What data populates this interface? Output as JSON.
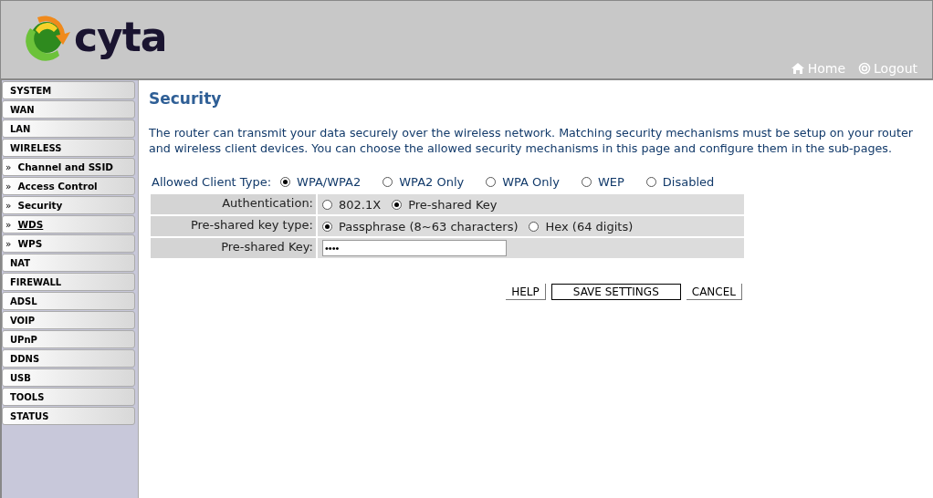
{
  "header": {
    "logo_text": "cyta",
    "links": [
      {
        "kind": "home",
        "label": "Home"
      },
      {
        "kind": "logout",
        "label": "Logout"
      }
    ]
  },
  "sidebar": {
    "items": [
      {
        "kind": "section",
        "label": "SYSTEM"
      },
      {
        "kind": "section",
        "label": "WAN"
      },
      {
        "kind": "section",
        "label": "LAN"
      },
      {
        "kind": "section",
        "label": "WIRELESS"
      },
      {
        "kind": "sub",
        "label": "Channel and SSID",
        "marker": "»"
      },
      {
        "kind": "sub",
        "label": "Access Control",
        "marker": "»"
      },
      {
        "kind": "sub",
        "label": "Security",
        "marker": "»"
      },
      {
        "kind": "sub",
        "label": "WDS",
        "marker": "»",
        "underlined": true
      },
      {
        "kind": "sub",
        "label": "WPS",
        "marker": "»"
      },
      {
        "kind": "section",
        "label": "NAT"
      },
      {
        "kind": "section",
        "label": "FIREWALL"
      },
      {
        "kind": "section",
        "label": "ADSL"
      },
      {
        "kind": "section",
        "label": "VOIP"
      },
      {
        "kind": "section",
        "label": "UPnP"
      },
      {
        "kind": "section",
        "label": "DDNS"
      },
      {
        "kind": "section",
        "label": "USB"
      },
      {
        "kind": "section",
        "label": "TOOLS"
      },
      {
        "kind": "section",
        "label": "STATUS"
      }
    ]
  },
  "page": {
    "title": "Security",
    "description": "The router can transmit your data securely over the wireless network. Matching security mechanisms must be setup on your router and wireless client devices. You can choose the allowed security mechanisms in this page and configure them in the sub-pages.",
    "client_type": {
      "label": "Allowed Client Type:",
      "options": [
        {
          "label": "WPA/WPA2",
          "selected": true
        },
        {
          "label": "WPA2 Only",
          "selected": false
        },
        {
          "label": "WPA Only",
          "selected": false
        },
        {
          "label": "WEP",
          "selected": false
        },
        {
          "label": "Disabled",
          "selected": false
        }
      ]
    },
    "rows": [
      {
        "kind": "radios",
        "label": "Authentication:",
        "options": [
          {
            "label": "802.1X",
            "selected": false
          },
          {
            "label": "Pre-shared Key",
            "selected": true
          }
        ]
      },
      {
        "kind": "radios",
        "label": "Pre-shared key type:",
        "options": [
          {
            "label": "Passphrase (8~63 characters)",
            "selected": true
          },
          {
            "label": "Hex (64 digits)",
            "selected": false
          }
        ]
      },
      {
        "kind": "input",
        "label": "Pre-shared Key:",
        "value": "••••"
      }
    ],
    "buttons": [
      {
        "label": "HELP",
        "kind": "plain"
      },
      {
        "label": "SAVE SETTINGS",
        "kind": "primary"
      },
      {
        "label": "CANCEL",
        "kind": "plain"
      }
    ]
  }
}
